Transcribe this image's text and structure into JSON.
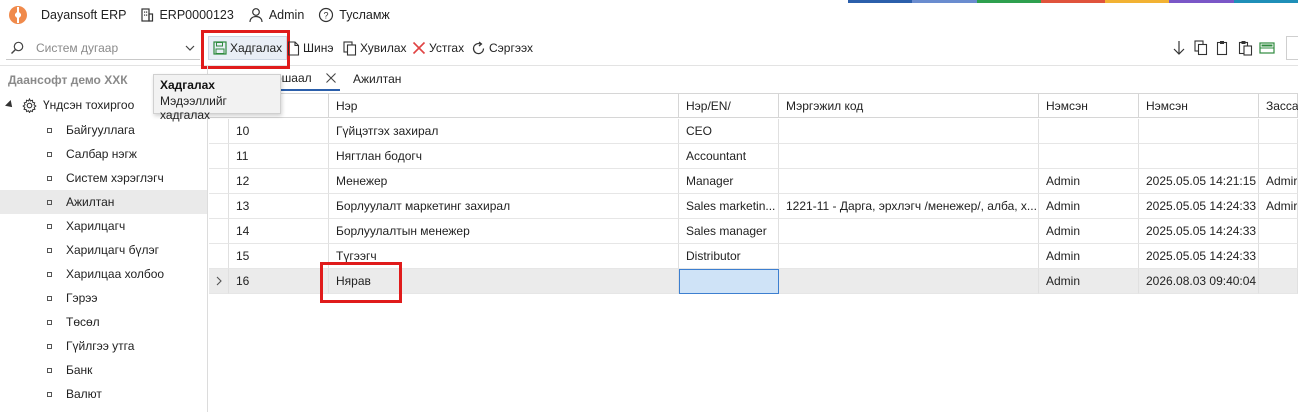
{
  "app": {
    "name": "Dayansoft ERP",
    "code": "ERP0000123",
    "user": "Admin",
    "help": "Тусламж"
  },
  "accent_colors": [
    "#2b5fab",
    "#6a8ccf",
    "#2ea04f",
    "#e0533c",
    "#f2b233",
    "#7a57c7",
    "#1f8fb8"
  ],
  "toolbar": {
    "search_placeholder": "Систем дугаар",
    "save": "Хадгалах",
    "new": "Шинэ",
    "copy": "Хувилах",
    "delete": "Устгах",
    "refresh": "Сэргээх"
  },
  "tooltip": {
    "title": "Хадгалах",
    "text": "Мэдээллийг хадгалах"
  },
  "sidebar": {
    "company": "Даансофт демо ХХК",
    "root": "Үндсэн тохиргоо",
    "items": [
      {
        "label": "Байгууллага"
      },
      {
        "label": "Салбар нэгж"
      },
      {
        "label": "Систем хэрэглэгч"
      },
      {
        "label": "Ажилтан"
      },
      {
        "label": "Харилцагч"
      },
      {
        "label": "Харилцагч бүлэг"
      },
      {
        "label": "Харилцаа холбоо"
      },
      {
        "label": "Гэрээ"
      },
      {
        "label": "Төсөл"
      },
      {
        "label": "Гүйлгээ утга"
      },
      {
        "label": "Банк"
      },
      {
        "label": "Валют"
      }
    ],
    "selected_index": 3
  },
  "tabs": [
    {
      "label": "ршаал"
    },
    {
      "label": "Ажилтан"
    }
  ],
  "grid": {
    "columns": [
      "Нэр",
      "Нэр/EN/",
      "Мэргэжил код",
      "Нэмсэн",
      "Нэмсэн",
      "Засса"
    ],
    "rows": [
      {
        "id": "10",
        "name": "Гүйцэтгэх захирал",
        "name_en": "CEO",
        "code": "",
        "added_by": "",
        "added_at": "",
        "edited_by": ""
      },
      {
        "id": "11",
        "name": "Нягтлан бодогч",
        "name_en": "Accountant",
        "code": "",
        "added_by": "",
        "added_at": "",
        "edited_by": ""
      },
      {
        "id": "12",
        "name": "Менежер",
        "name_en": "Manager",
        "code": "",
        "added_by": "Admin",
        "added_at": "2025.05.05 14:21:15",
        "edited_by": "Admir"
      },
      {
        "id": "13",
        "name": "Борлуулалт маркетинг захирал",
        "name_en": "Sales marketin...",
        "code": "1221-11 - Дарга, эрхлэгч /менежер/, алба, х...",
        "added_by": "Admin",
        "added_at": "2025.05.05 14:24:33",
        "edited_by": "Admir"
      },
      {
        "id": "14",
        "name": "Борлуулалтын менежер",
        "name_en": "Sales manager",
        "code": "",
        "added_by": "Admin",
        "added_at": "2025.05.05 14:24:33",
        "edited_by": ""
      },
      {
        "id": "15",
        "name": "Түгээгч",
        "name_en": "Distributor",
        "code": "",
        "added_by": "Admin",
        "added_at": "2025.05.05 14:24:33",
        "edited_by": ""
      },
      {
        "id": "16",
        "name": "Нярав",
        "name_en": "",
        "code": "",
        "added_by": "Admin",
        "added_at": "2026.08.03 09:40:04",
        "edited_by": ""
      }
    ],
    "current_row_index": 6
  }
}
